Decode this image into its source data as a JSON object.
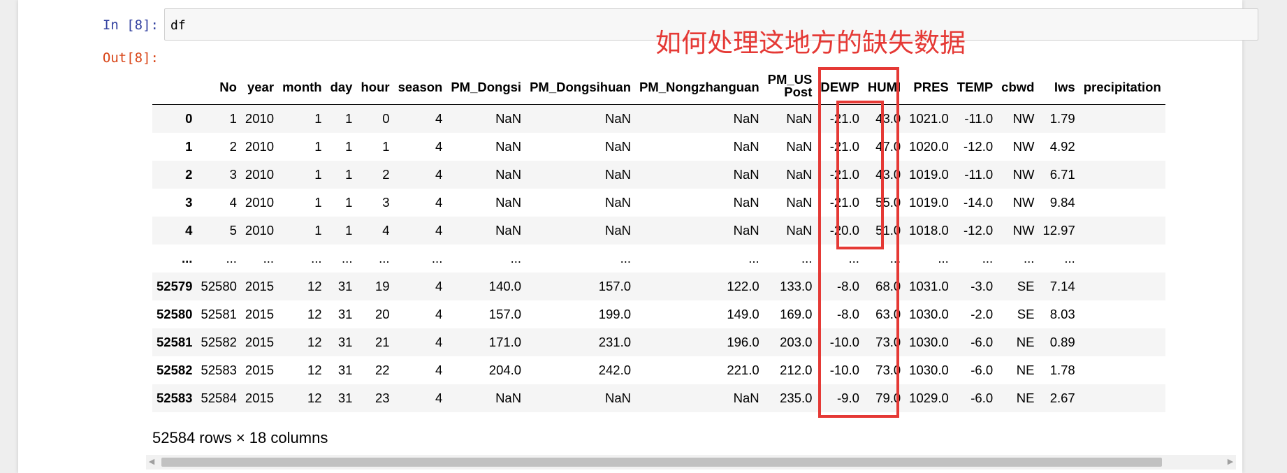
{
  "notebook": {
    "in_prompt": "In  [8]:",
    "out_prompt": "Out[8]:",
    "code": "df"
  },
  "annotation": {
    "text": "如何处理这地方的缺失数据",
    "color": "#e53935"
  },
  "dataframe": {
    "columns": [
      "",
      "No",
      "year",
      "month",
      "day",
      "hour",
      "season",
      "PM_Dongsi",
      "PM_Dongsihuan",
      "PM_Nongzhanguan",
      "PM_US Post",
      "DEWP",
      "HUMI",
      "PRES",
      "TEMP",
      "cbwd",
      "Iws",
      "precipitation"
    ],
    "rows": [
      [
        "0",
        "1",
        "2010",
        "1",
        "1",
        "0",
        "4",
        "NaN",
        "NaN",
        "NaN",
        "NaN",
        "-21.0",
        "43.0",
        "1021.0",
        "-11.0",
        "NW",
        "1.79",
        ""
      ],
      [
        "1",
        "2",
        "2010",
        "1",
        "1",
        "1",
        "4",
        "NaN",
        "NaN",
        "NaN",
        "NaN",
        "-21.0",
        "47.0",
        "1020.0",
        "-12.0",
        "NW",
        "4.92",
        ""
      ],
      [
        "2",
        "3",
        "2010",
        "1",
        "1",
        "2",
        "4",
        "NaN",
        "NaN",
        "NaN",
        "NaN",
        "-21.0",
        "43.0",
        "1019.0",
        "-11.0",
        "NW",
        "6.71",
        ""
      ],
      [
        "3",
        "4",
        "2010",
        "1",
        "1",
        "3",
        "4",
        "NaN",
        "NaN",
        "NaN",
        "NaN",
        "-21.0",
        "55.0",
        "1019.0",
        "-14.0",
        "NW",
        "9.84",
        ""
      ],
      [
        "4",
        "5",
        "2010",
        "1",
        "1",
        "4",
        "4",
        "NaN",
        "NaN",
        "NaN",
        "NaN",
        "-20.0",
        "51.0",
        "1018.0",
        "-12.0",
        "NW",
        "12.97",
        ""
      ],
      [
        "...",
        "...",
        "...",
        "...",
        "...",
        "...",
        "...",
        "...",
        "...",
        "...",
        "...",
        "...",
        "...",
        "...",
        "...",
        "...",
        "...",
        ""
      ],
      [
        "52579",
        "52580",
        "2015",
        "12",
        "31",
        "19",
        "4",
        "140.0",
        "157.0",
        "122.0",
        "133.0",
        "-8.0",
        "68.0",
        "1031.0",
        "-3.0",
        "SE",
        "7.14",
        ""
      ],
      [
        "52580",
        "52581",
        "2015",
        "12",
        "31",
        "20",
        "4",
        "157.0",
        "199.0",
        "149.0",
        "169.0",
        "-8.0",
        "63.0",
        "1030.0",
        "-2.0",
        "SE",
        "8.03",
        ""
      ],
      [
        "52581",
        "52582",
        "2015",
        "12",
        "31",
        "21",
        "4",
        "171.0",
        "231.0",
        "196.0",
        "203.0",
        "-10.0",
        "73.0",
        "1030.0",
        "-6.0",
        "NE",
        "0.89",
        ""
      ],
      [
        "52582",
        "52583",
        "2015",
        "12",
        "31",
        "22",
        "4",
        "204.0",
        "242.0",
        "221.0",
        "212.0",
        "-10.0",
        "73.0",
        "1030.0",
        "-6.0",
        "NE",
        "1.78",
        ""
      ],
      [
        "52583",
        "52584",
        "2015",
        "12",
        "31",
        "23",
        "4",
        "NaN",
        "NaN",
        "NaN",
        "235.0",
        "-9.0",
        "79.0",
        "1029.0",
        "-6.0",
        "NE",
        "2.67",
        ""
      ]
    ],
    "summary": "52584 rows × 18 columns"
  }
}
